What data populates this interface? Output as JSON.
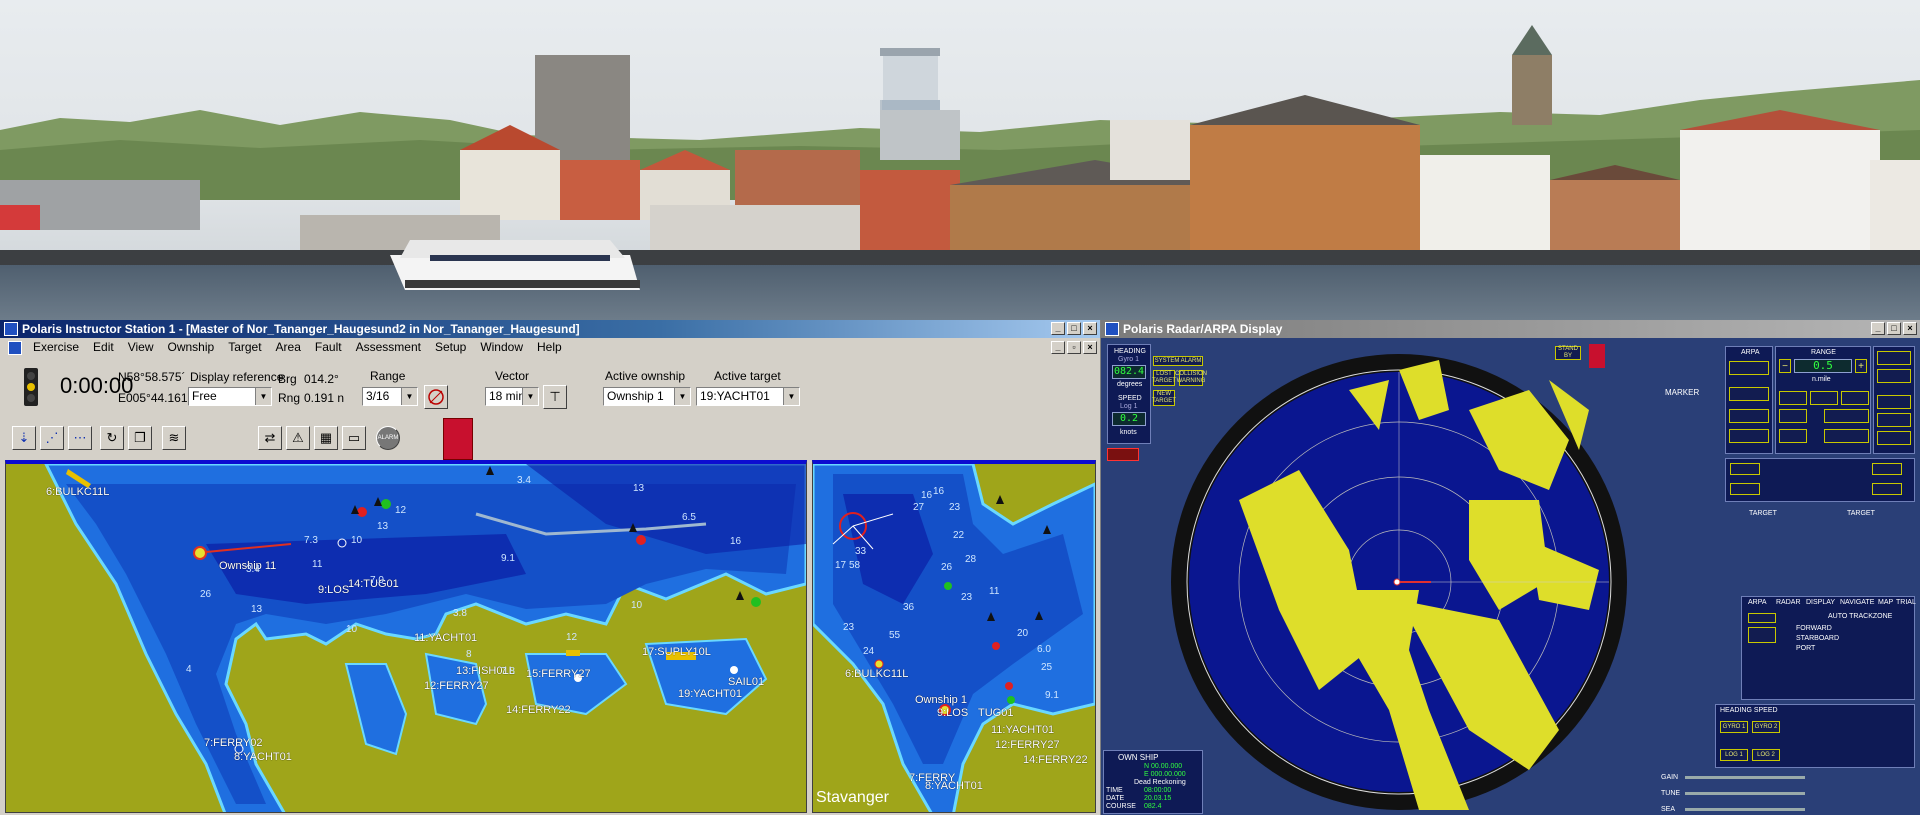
{
  "colors": {
    "sea_dark": "#0a1ea5",
    "sea_mid": "#1f6fe0",
    "land": "#9fa51a",
    "radar_bg": "#0a1690",
    "echo": "#dede2a",
    "titlebar_active": "#0a246a"
  },
  "instructor": {
    "title": "Polaris Instructor Station 1 - [Master of Nor_Tananger_Haugesund2 in Nor_Tananger_Haugesund]",
    "menu": [
      "Exercise",
      "Edit",
      "View",
      "Ownship",
      "Target",
      "Area",
      "Fault",
      "Assessment",
      "Setup",
      "Window",
      "Help"
    ],
    "clock": "0:00:00",
    "lat": "N58°58.575´",
    "lon": "E005°44.161´",
    "display_reference_label": "Display reference",
    "display_reference_value": "Free",
    "brg_label": "Brg",
    "brg_value": "014.2°",
    "rng_label": "Rng",
    "rng_value": "0.191 n",
    "range_label": "Range",
    "range_value": "3/16",
    "vector_label": "Vector",
    "vector_value": "18 min",
    "active_ownship_label": "Active ownship",
    "active_ownship_value": "Ownship 1",
    "active_target_label": "Active target",
    "active_target_value": "19:YACHT01",
    "toolbar_icons": [
      "traffic-light-icon",
      "map-reference-icon",
      "vector-mode-icon",
      "route-down-icon",
      "route-node-icon",
      "route-end-icon",
      "loop-icon",
      "copy-icon",
      "wave-icon",
      "link-icon",
      "warning-icon",
      "chart-grid-icon",
      "card-icon",
      "alarm-icon",
      "coat-of-arms-icon"
    ],
    "alarm_label": "ALARM"
  },
  "main_chart": {
    "labels": [
      {
        "text": "6:BULKC11L"
      },
      {
        "text": "Ownship 11"
      },
      {
        "text": "9:LOS"
      },
      {
        "text": "14:TUG01"
      },
      {
        "text": "11:YACHT01"
      },
      {
        "text": "13:FISH01L"
      },
      {
        "text": "15:FERRY27"
      },
      {
        "text": "12:FERRY27"
      },
      {
        "text": "17:SUPLY10L"
      },
      {
        "text": "19:YACHT01"
      },
      {
        "text": "SAIL01"
      },
      {
        "text": "14:FERRY22"
      },
      {
        "text": "7:FERRY02"
      },
      {
        "text": "8:YACHT01"
      }
    ],
    "depths": [
      "3.4",
      "12",
      "13",
      "7.3",
      "10",
      "13",
      "6.5",
      "16",
      "7.0",
      "9.1",
      "26",
      "3.8",
      "10",
      "3.4",
      "13",
      "11",
      "10",
      "8",
      "12",
      "7.8",
      "4"
    ]
  },
  "overview_chart": {
    "place_name": "Stavanger",
    "labels": [
      {
        "text": "6:BULKC11L"
      },
      {
        "text": "Ownship 1"
      },
      {
        "text": "9:LOS"
      },
      {
        "text": "TUG01"
      },
      {
        "text": "11:YACHT01"
      },
      {
        "text": "12:FERRY27"
      },
      {
        "text": "14:FERRY22"
      },
      {
        "text": "7:FERRY"
      },
      {
        "text": "8:YACHT01"
      }
    ],
    "depths": [
      "16",
      "27",
      "23",
      "17",
      "33",
      "22",
      "26",
      "28",
      "23",
      "36",
      "55",
      "24",
      "23",
      "6.0",
      "9.1",
      "20",
      "25",
      "16",
      "11",
      "58"
    ]
  },
  "radar": {
    "title": "Polaris Radar/ARPA Display",
    "heading_label": "HEADING",
    "heading_sub": "Gyro 1",
    "heading_value": "082.4",
    "heading_unit": "degrees",
    "speed_label": "SPEED",
    "speed_sub": "Log 1",
    "speed_value": "0.2",
    "speed_unit": "knots",
    "standby_label": "STAND BY",
    "system_alarm": "SYSTEM ALARM",
    "lost_target": "LOST TARGET",
    "collision_warning": "COLLISION WARNING",
    "new_target": "NEW TARGET",
    "arpa_label": "ARPA",
    "range_label": "RANGE",
    "range_value": "0.5",
    "range_unit": "n.mile",
    "marker_label": "MARKER",
    "target_label": "TARGET",
    "own_ship_label": "OWN SHIP",
    "dead_reckoning": "Dead Reckoning",
    "time_label": "TIME",
    "time_value": "08:00:00",
    "date_label": "DATE",
    "date_value": "20.03.15",
    "course_label": "COURSE",
    "course_value": "082.4",
    "lat_value": "N 00.00.000",
    "lon_value": "E 000.00.000",
    "tabs": [
      "ARPA",
      "RADAR",
      "DISPLAY",
      "NAVIGATE",
      "MAP",
      "TRIAL"
    ],
    "auto_trackzone": "AUTO TRACKZONE",
    "forward": "FORWARD",
    "starboard": "STARBOARD",
    "port": "PORT",
    "heading_speed": "HEADING SPEED",
    "gyro1": "GYRO 1",
    "gyro2": "GYRO 2",
    "log1": "LOG 1",
    "log2": "LOG 2",
    "gain_label": "GAIN",
    "tune_label": "TUNE",
    "sea_label": "SEA"
  }
}
